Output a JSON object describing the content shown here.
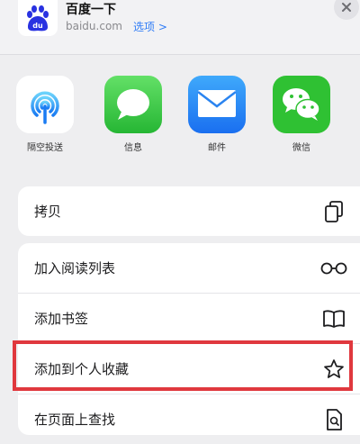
{
  "header": {
    "title": "百度一下",
    "url": "baidu.com",
    "options_label": "选项 >",
    "site_icon": "baidu-paw-logo",
    "close_icon": "close-icon"
  },
  "apps": [
    {
      "label": "隔空投送",
      "icon": "airdrop-icon"
    },
    {
      "label": "信息",
      "icon": "messages-icon"
    },
    {
      "label": "邮件",
      "icon": "mail-icon"
    },
    {
      "label": "微信",
      "icon": "wechat-icon"
    }
  ],
  "actions": {
    "copy": {
      "label": "拷贝",
      "icon": "copy-icon"
    },
    "reading_list": {
      "label": "加入阅读列表",
      "icon": "glasses-icon"
    },
    "bookmark": {
      "label": "添加书签",
      "icon": "book-icon"
    },
    "favorites": {
      "label": "添加到个人收藏",
      "icon": "star-icon"
    },
    "find": {
      "label": "在页面上查找",
      "icon": "find-document-icon"
    }
  },
  "colors": {
    "accent_blue": "#2f7cf6",
    "highlight_red": "#e0383e",
    "messages_green": "#3ccf4e",
    "mail_blue": "#1e8cf7",
    "wechat_green": "#2dc100"
  }
}
